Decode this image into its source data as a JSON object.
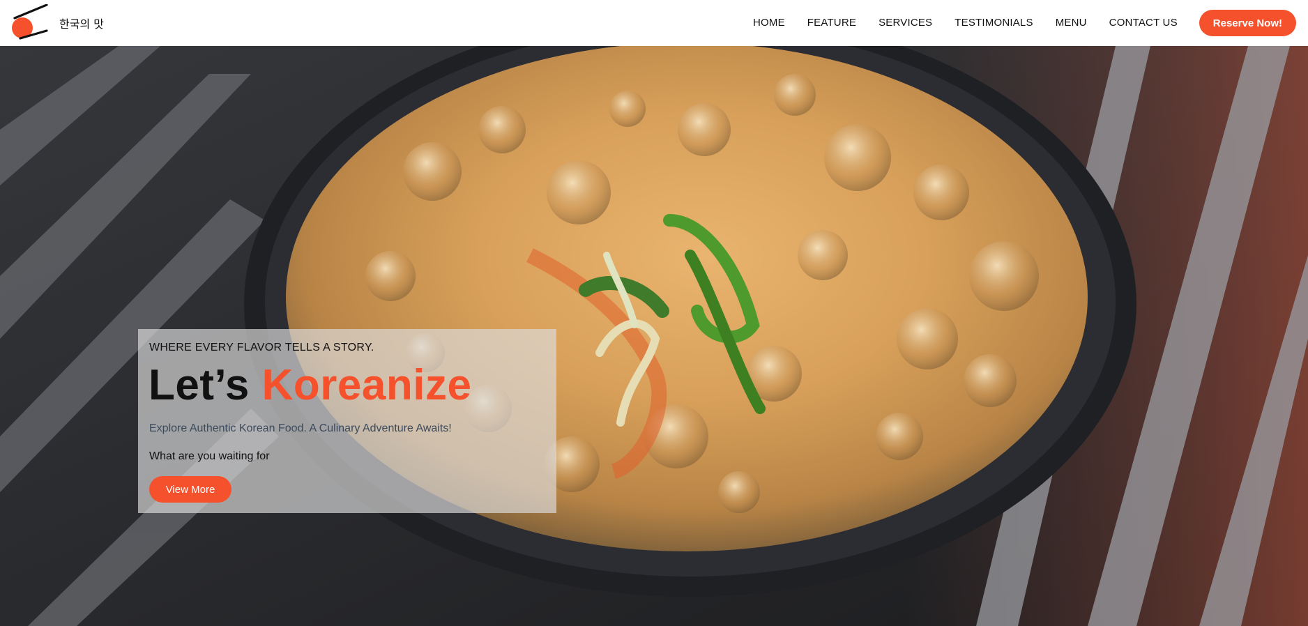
{
  "brand": {
    "name": "한국의 맛",
    "logo": "circle-with-chopsticks-logo",
    "accent_color": "#f4512c"
  },
  "nav": {
    "items": [
      {
        "label": "HOME"
      },
      {
        "label": "FEATURE"
      },
      {
        "label": "SERVICES"
      },
      {
        "label": "TESTIMONIALS"
      },
      {
        "label": "MENU"
      },
      {
        "label": "CONTACT US"
      }
    ],
    "cta_label": "Reserve Now!"
  },
  "hero": {
    "background": "bubbling-korean-stew-on-grill",
    "tagline": "WHERE EVERY FLAVOR TELLS A STORY.",
    "headline_prefix": "Let’s ",
    "headline_accent": "Koreanize",
    "subtext": "Explore Authentic Korean Food. A Culinary Adventure Awaits!",
    "question": "What are you waiting for",
    "button_label": "View More"
  }
}
